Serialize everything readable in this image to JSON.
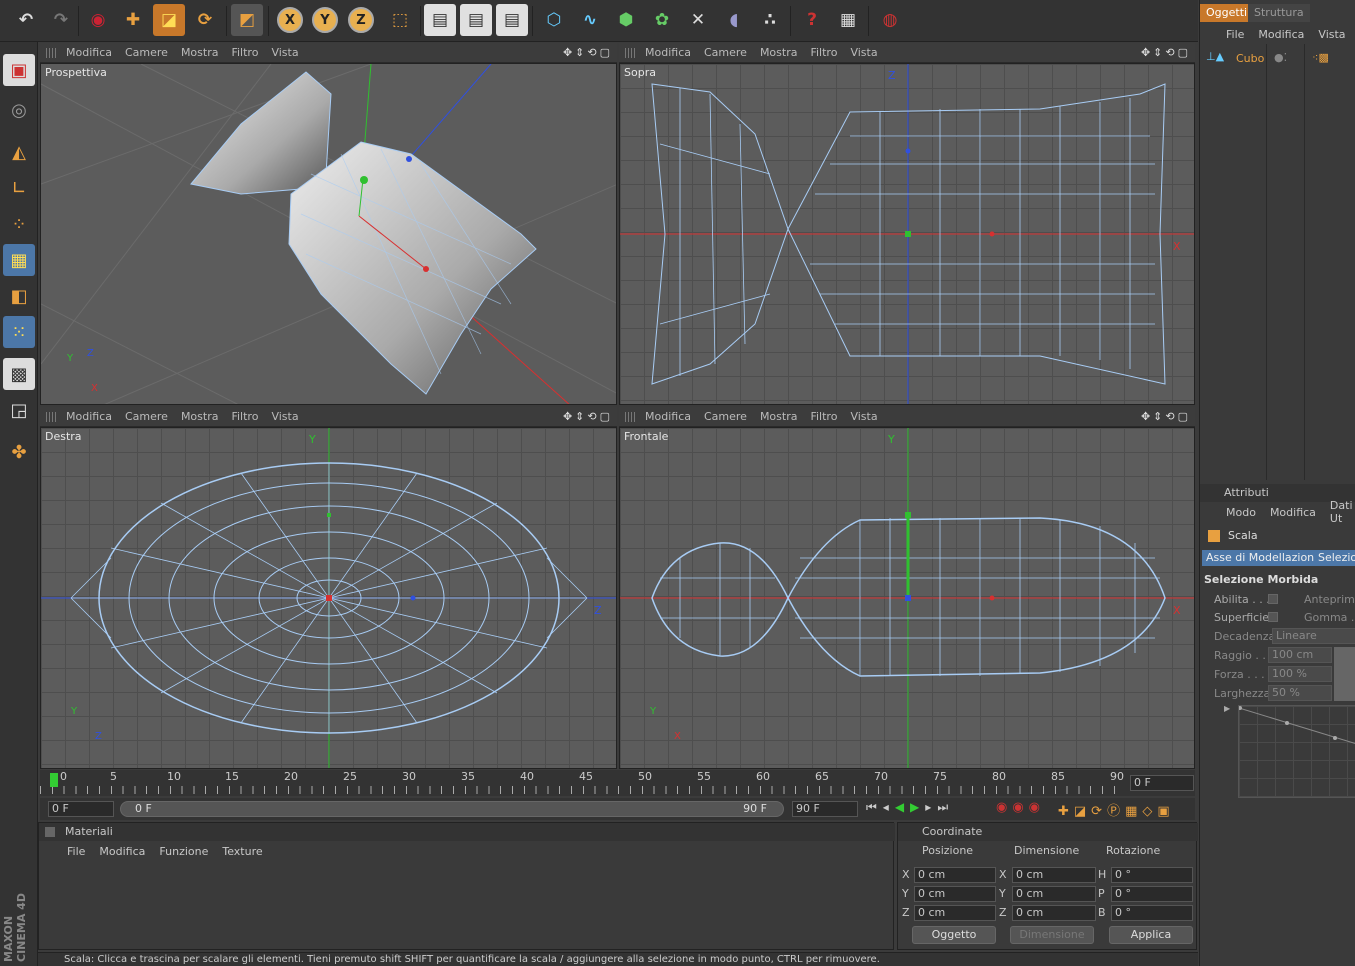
{
  "viewport_menu": [
    "Modifica",
    "Camere",
    "Mostra",
    "Filtro",
    "Vista"
  ],
  "viewports": {
    "tl": {
      "label": "Prospettiva"
    },
    "tr": {
      "label": "Sopra",
      "axis_a": "Z",
      "axis_b": "X"
    },
    "bl": {
      "label": "Destra",
      "axis_a": "Y",
      "axis_b": "Z"
    },
    "br": {
      "label": "Frontale",
      "axis_a": "Y",
      "axis_b": "X"
    }
  },
  "toolbar_axes": [
    "X",
    "Y",
    "Z"
  ],
  "object_manager": {
    "tabs": [
      "Oggetti",
      "Struttura"
    ],
    "menu": [
      "File",
      "Modifica",
      "Vista",
      "O"
    ],
    "item": "Cubo"
  },
  "attributes": {
    "title": "Attributi",
    "menu": [
      "Modo",
      "Modifica",
      "Dati Ut"
    ],
    "tool_name": "Scala",
    "tabs": [
      "Asse di Modellazione",
      "Selezion"
    ],
    "section": "Selezione Morbida",
    "rows": [
      {
        "label": "Abilita . . .",
        "right": "Anteprima"
      },
      {
        "label": "Superficie",
        "right": "Gomma . ."
      },
      {
        "label": "Decadenza",
        "value": "Lineare"
      },
      {
        "label": "Raggio . .",
        "value": "100 cm"
      },
      {
        "label": "Forza . . .",
        "value": "100 %"
      },
      {
        "label": "Larghezza",
        "value": "50 %"
      }
    ]
  },
  "timeline": {
    "ticks": [
      "0",
      "5",
      "10",
      "15",
      "20",
      "25",
      "30",
      "35",
      "40",
      "45",
      "50",
      "55",
      "60",
      "65",
      "70",
      "75",
      "80",
      "85",
      "90"
    ],
    "current_frame": "0 F",
    "start_field": "0 F",
    "range_start": "0 F",
    "range_end": "90 F",
    "end_field": "90 F"
  },
  "materials": {
    "title": "Materiali",
    "menu": [
      "File",
      "Modifica",
      "Funzione",
      "Texture"
    ]
  },
  "coordinates": {
    "title": "Coordinate",
    "headers": [
      "Posizione",
      "Dimensione",
      "Rotazione"
    ],
    "rows": [
      {
        "a": "X",
        "av": "0 cm",
        "b": "X",
        "bv": "0 cm",
        "c": "H",
        "cv": "0 °"
      },
      {
        "a": "Y",
        "av": "0 cm",
        "b": "Y",
        "bv": "0 cm",
        "c": "P",
        "cv": "0 °"
      },
      {
        "a": "Z",
        "av": "0 cm",
        "b": "Z",
        "bv": "0 cm",
        "c": "B",
        "cv": "0 °"
      }
    ],
    "mode_select": "Oggetto",
    "size_select": "Dimensione",
    "apply": "Applica"
  },
  "brand": "MAXON CINEMA 4D",
  "status": "Scala: Clicca e trascina per scalare gli elementi. Tieni premuto shift SHIFT per quantificare la scala / aggiungere alla selezione in modo punto, CTRL per rimuovere.",
  "colors": {
    "accent": "#c8782a",
    "select_blue": "#4c77a8",
    "wire": "#a8ccf4",
    "xaxis": "#d83030",
    "yaxis": "#30c030",
    "zaxis": "#3050e0"
  }
}
